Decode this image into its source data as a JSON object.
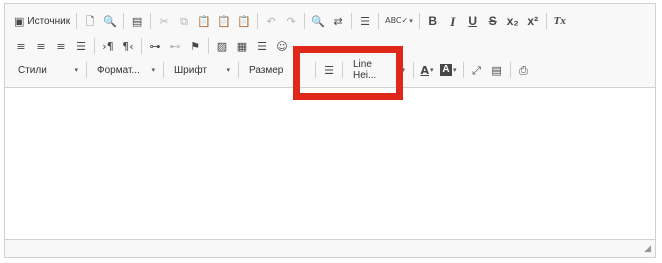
{
  "toolbar": {
    "row1": {
      "source_label": "Источник",
      "spellcheck_glyph": "ABC✓",
      "bold": "B",
      "italic": "I",
      "underline": "U",
      "strike": "S",
      "subscript": "x₂",
      "superscript": "x²",
      "remove_format": "Tx"
    },
    "row3": {
      "styles": "Стили",
      "format": "Формат...",
      "font": "Шрифт",
      "size": "Размер",
      "line_height": "Line Hei..."
    }
  },
  "highlight": {
    "color": "#e0281a"
  },
  "icons": {
    "source": "source-icon",
    "new_page": "new-page-icon",
    "preview": "preview-icon",
    "templates": "templates-icon",
    "cut": "cut-icon",
    "copy": "copy-icon",
    "paste": "paste-icon",
    "paste_text": "paste-text-icon",
    "paste_word": "paste-word-icon",
    "undo": "undo-icon",
    "redo": "redo-icon",
    "find": "find-icon",
    "replace": "replace-icon",
    "select_all": "select-all-icon",
    "spellcheck": "spellcheck-icon"
  }
}
